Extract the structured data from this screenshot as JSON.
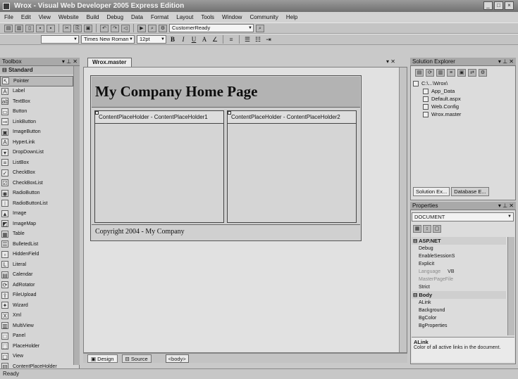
{
  "window": {
    "title": "Wrox - Visual Web Developer 2005 Express Edition"
  },
  "menu": [
    "File",
    "Edit",
    "View",
    "Website",
    "Build",
    "Debug",
    "Data",
    "Format",
    "Layout",
    "Tools",
    "Window",
    "Community",
    "Help"
  ],
  "toolbar": {
    "config_combo": "CustomerReady"
  },
  "format_toolbar": {
    "font_name": "Times New Roman",
    "font_size": "12pt",
    "bold": "B",
    "italic": "I",
    "underline": "U"
  },
  "toolbox": {
    "title": "Toolbox",
    "group": "Standard",
    "items": [
      {
        "label": "Pointer",
        "icon": "pointer-icon",
        "glyph": "↖"
      },
      {
        "label": "Label",
        "icon": "label-icon",
        "glyph": "A"
      },
      {
        "label": "TextBox",
        "icon": "textbox-icon",
        "glyph": "ab"
      },
      {
        "label": "Button",
        "icon": "button-icon",
        "glyph": "▭"
      },
      {
        "label": "LinkButton",
        "icon": "linkbutton-icon",
        "glyph": "⊸"
      },
      {
        "label": "ImageButton",
        "icon": "imagebutton-icon",
        "glyph": "▣"
      },
      {
        "label": "HyperLink",
        "icon": "hyperlink-icon",
        "glyph": "A"
      },
      {
        "label": "DropDownList",
        "icon": "dropdownlist-icon",
        "glyph": "▾"
      },
      {
        "label": "ListBox",
        "icon": "listbox-icon",
        "glyph": "≡"
      },
      {
        "label": "CheckBox",
        "icon": "checkbox-icon",
        "glyph": "✓"
      },
      {
        "label": "CheckBoxList",
        "icon": "checkboxlist-icon",
        "glyph": "☑"
      },
      {
        "label": "RadioButton",
        "icon": "radiobutton-icon",
        "glyph": "◉"
      },
      {
        "label": "RadioButtonList",
        "icon": "radiobuttonlist-icon",
        "glyph": "⁝"
      },
      {
        "label": "Image",
        "icon": "image-icon",
        "glyph": "▲"
      },
      {
        "label": "ImageMap",
        "icon": "imagemap-icon",
        "glyph": "◩"
      },
      {
        "label": "Table",
        "icon": "table-icon",
        "glyph": "▦"
      },
      {
        "label": "BulletedList",
        "icon": "bulletedlist-icon",
        "glyph": "☰"
      },
      {
        "label": "HiddenField",
        "icon": "hiddenfield-icon",
        "glyph": "▫"
      },
      {
        "label": "Literal",
        "icon": "literal-icon",
        "glyph": "L"
      },
      {
        "label": "Calendar",
        "icon": "calendar-icon",
        "glyph": "▤"
      },
      {
        "label": "AdRotator",
        "icon": "adrotator-icon",
        "glyph": "⟳"
      },
      {
        "label": "FileUpload",
        "icon": "fileupload-icon",
        "glyph": "⇪"
      },
      {
        "label": "Wizard",
        "icon": "wizard-icon",
        "glyph": "✦"
      },
      {
        "label": "Xml",
        "icon": "xml-icon",
        "glyph": "X"
      },
      {
        "label": "MultiView",
        "icon": "multiview-icon",
        "glyph": "▥"
      },
      {
        "label": "Panel",
        "icon": "panel-icon",
        "glyph": "□"
      },
      {
        "label": "PlaceHolder",
        "icon": "placeholder-icon",
        "glyph": "⬚"
      },
      {
        "label": "View",
        "icon": "view-icon",
        "glyph": "▢"
      },
      {
        "label": "ContentPlaceHolder",
        "icon": "contentplaceholder-icon",
        "glyph": "▧"
      }
    ]
  },
  "editor": {
    "tab": "Wrox.master",
    "heading": "My Company Home Page",
    "placeholder1": "ContentPlaceHolder - ContentPlaceHolder1",
    "placeholder2": "ContentPlaceHolder - ContentPlaceHolder2",
    "footer": "Copyright 2004 - My Company",
    "view_design": "Design",
    "view_source": "Source",
    "tag": "<body>"
  },
  "solution_explorer": {
    "title": "Solution Explorer",
    "tree": [
      {
        "label": "C:\\...\\Wrox\\",
        "depth": 0
      },
      {
        "label": "App_Data",
        "depth": 1
      },
      {
        "label": "Default.aspx",
        "depth": 1
      },
      {
        "label": "Web.Config",
        "depth": 1
      },
      {
        "label": "Wrox.master",
        "depth": 1
      }
    ],
    "tab_solution": "Solution Ex...",
    "tab_database": "Database E..."
  },
  "properties": {
    "title": "Properties",
    "object": "DOCUMENT",
    "categories": [
      {
        "name": "ASP.NET",
        "rows": [
          {
            "name": "Debug",
            "value": ""
          },
          {
            "name": "EnableSessionS",
            "value": ""
          },
          {
            "name": "Explicit",
            "value": ""
          },
          {
            "name": "Language",
            "value": "VB",
            "muted": true
          },
          {
            "name": "MasterPageFile",
            "value": "",
            "muted": true
          },
          {
            "name": "Strict",
            "value": ""
          }
        ]
      },
      {
        "name": "Body",
        "rows": [
          {
            "name": "ALink",
            "value": ""
          },
          {
            "name": "Background",
            "value": ""
          },
          {
            "name": "BgColor",
            "value": ""
          },
          {
            "name": "BgProperties",
            "value": ""
          }
        ]
      }
    ],
    "desc_title": "ALink",
    "desc_text": "Color of all active links in the document."
  },
  "status": "Ready"
}
